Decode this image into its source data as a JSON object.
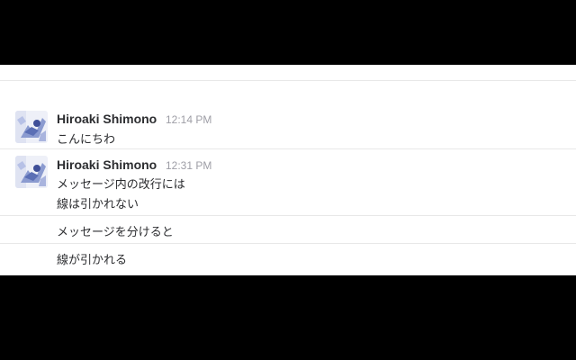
{
  "colors": {
    "background_band": "#000000",
    "chat_background": "#ffffff",
    "separator": "#e8e8e8",
    "author_text": "#2c2d30",
    "timestamp_text": "#9e9ea6",
    "avatar_accent": "#5b6fb5"
  },
  "messages": [
    {
      "author": "Hiroaki Shimono",
      "time": "12:14 PM",
      "avatar_icon": "user-avatar",
      "lines": [
        "こんにちわ"
      ]
    },
    {
      "author": "Hiroaki Shimono",
      "time": "12:31 PM",
      "avatar_icon": "user-avatar",
      "lines": [
        "メッセージ内の改行には",
        "線は引かれない"
      ]
    },
    {
      "lines": [
        "メッセージを分けると"
      ]
    },
    {
      "lines": [
        "線が引かれる"
      ]
    }
  ]
}
